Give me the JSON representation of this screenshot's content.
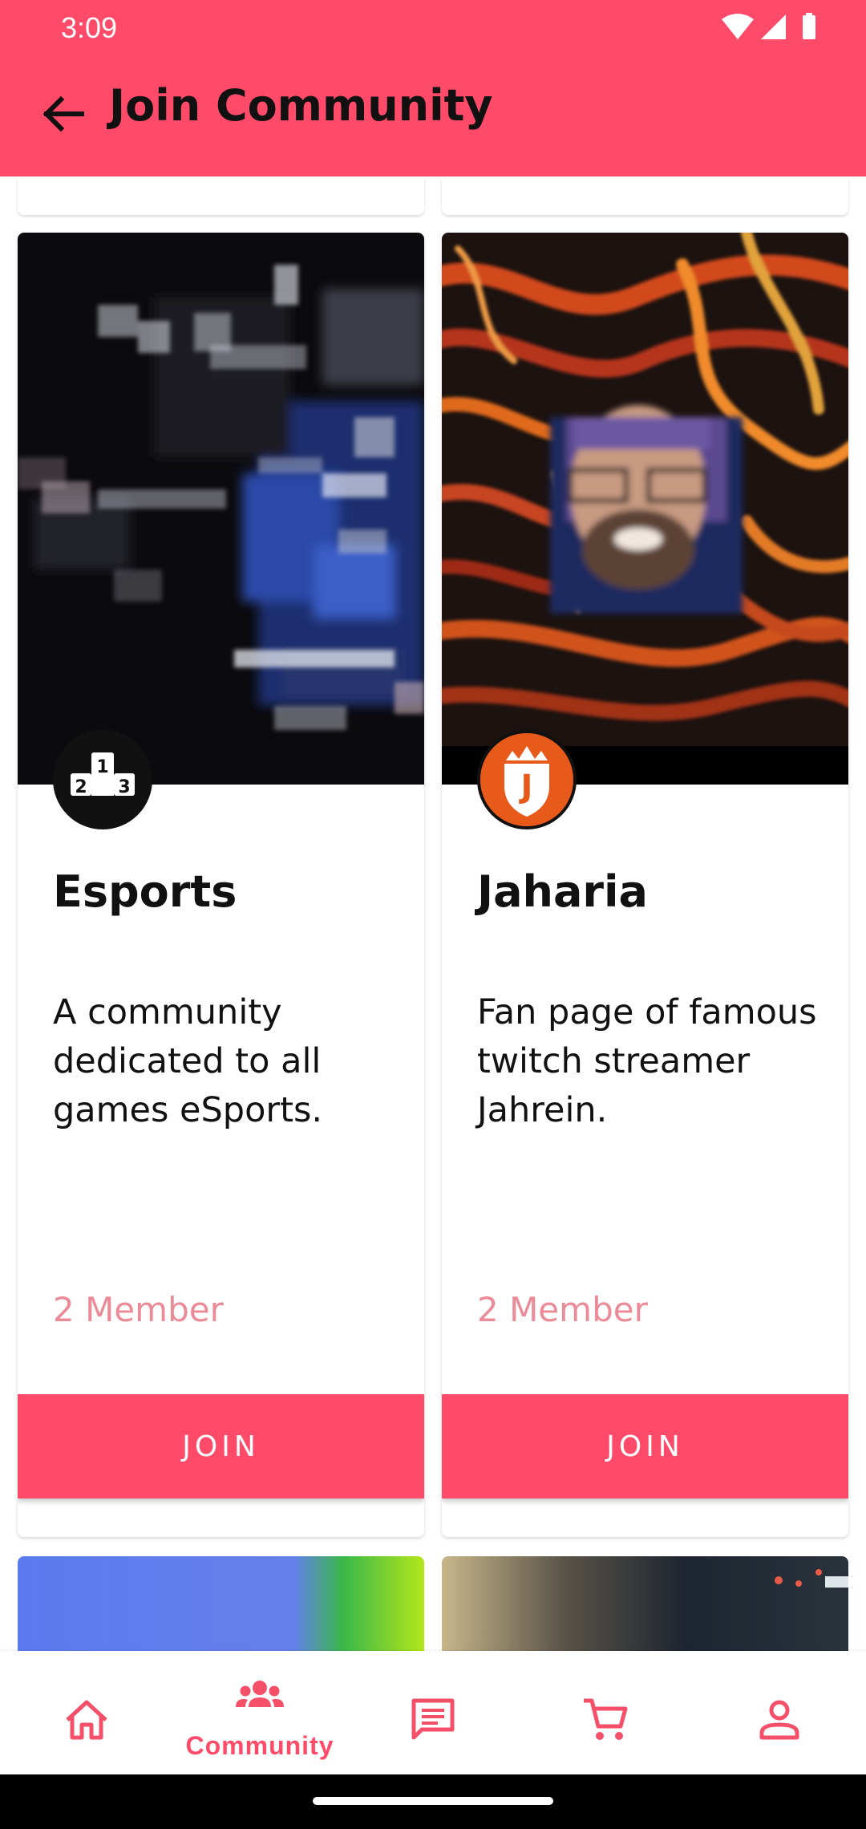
{
  "status_bar": {
    "time": "3:09"
  },
  "app_bar": {
    "title": "Join Community"
  },
  "communities": [
    {
      "name": "Esports",
      "description": "A community dedicated to all games eSports.",
      "members": "2 Member",
      "join_label": "JOIN",
      "avatar_icon": "podium-icon",
      "avatar_digits": [
        "1",
        "2",
        "3"
      ]
    },
    {
      "name": "Jaharia",
      "description": "Fan page of famous twitch streamer Jahrein.",
      "members": "2 Member",
      "join_label": "JOIN",
      "avatar_icon": "crowned-shield-logo",
      "avatar_letter": "J"
    }
  ],
  "bottom_nav": {
    "items": [
      {
        "icon": "home-icon",
        "label": ""
      },
      {
        "icon": "community-icon",
        "label": "Community",
        "active": true
      },
      {
        "icon": "chat-icon",
        "label": ""
      },
      {
        "icon": "cart-icon",
        "label": ""
      },
      {
        "icon": "profile-icon",
        "label": ""
      }
    ]
  },
  "colors": {
    "accent": "#ff4a69",
    "member_text": "#ec8b98",
    "nav_icon": "#f4506a"
  }
}
